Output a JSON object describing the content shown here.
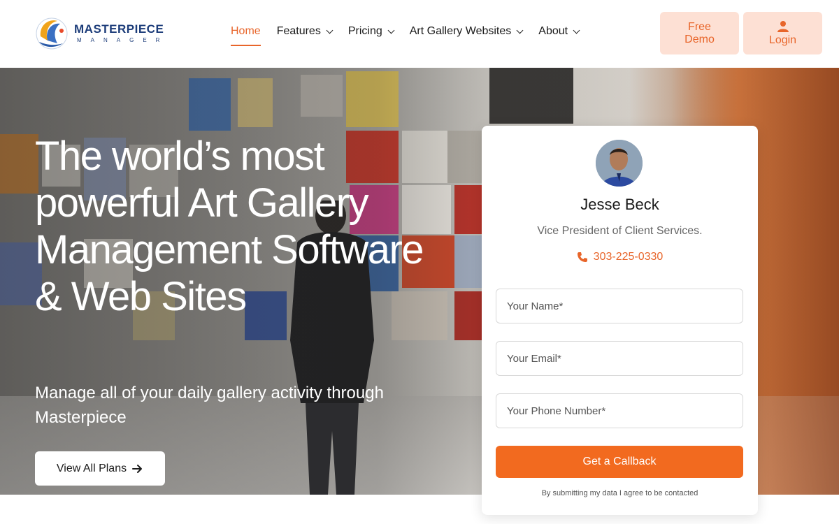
{
  "brand": {
    "name_main": "MASTERPIECE",
    "name_sub": "MANAGER",
    "accent": "#e8652a"
  },
  "nav": {
    "items": [
      {
        "label": "Home",
        "active": true,
        "dropdown": false
      },
      {
        "label": "Features",
        "active": false,
        "dropdown": true
      },
      {
        "label": "Pricing",
        "active": false,
        "dropdown": true
      },
      {
        "label": "Art Gallery Websites",
        "active": false,
        "dropdown": true
      },
      {
        "label": "About",
        "active": false,
        "dropdown": true
      }
    ]
  },
  "header_buttons": {
    "demo_line1": "Free",
    "demo_line2": "Demo",
    "login": "Login"
  },
  "hero": {
    "headline": "The world’s most powerful Art Gallery Management Software & Web Sites",
    "subline": "Manage all of your daily gallery activity through Masterpiece",
    "cta": "View All Plans"
  },
  "callback_card": {
    "name": "Jesse Beck",
    "title": "Vice President of Client Services.",
    "phone": "303-225-0330",
    "name_placeholder": "Your Name*",
    "email_placeholder": "Your Email*",
    "phone_placeholder": "Your Phone Number*",
    "submit": "Get a Callback",
    "consent": "By submitting my data I agree to be contacted"
  }
}
